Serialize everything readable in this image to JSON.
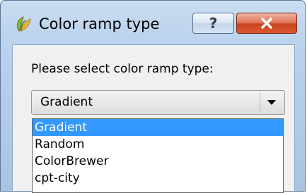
{
  "window": {
    "title": "Color ramp type",
    "help_glyph": "?",
    "close_icon": "close-x-icon",
    "app_icon": "qgis-logo-icon"
  },
  "dialog": {
    "prompt": "Please select color ramp type:",
    "combo": {
      "selected": "Gradient",
      "options": [
        "Gradient",
        "Random",
        "ColorBrewer",
        "cpt-city"
      ],
      "highlighted_index": 0
    }
  },
  "colors": {
    "selection": "#3399ff",
    "close_button": "#c9431f",
    "titlebar": "#b9d1ec"
  }
}
